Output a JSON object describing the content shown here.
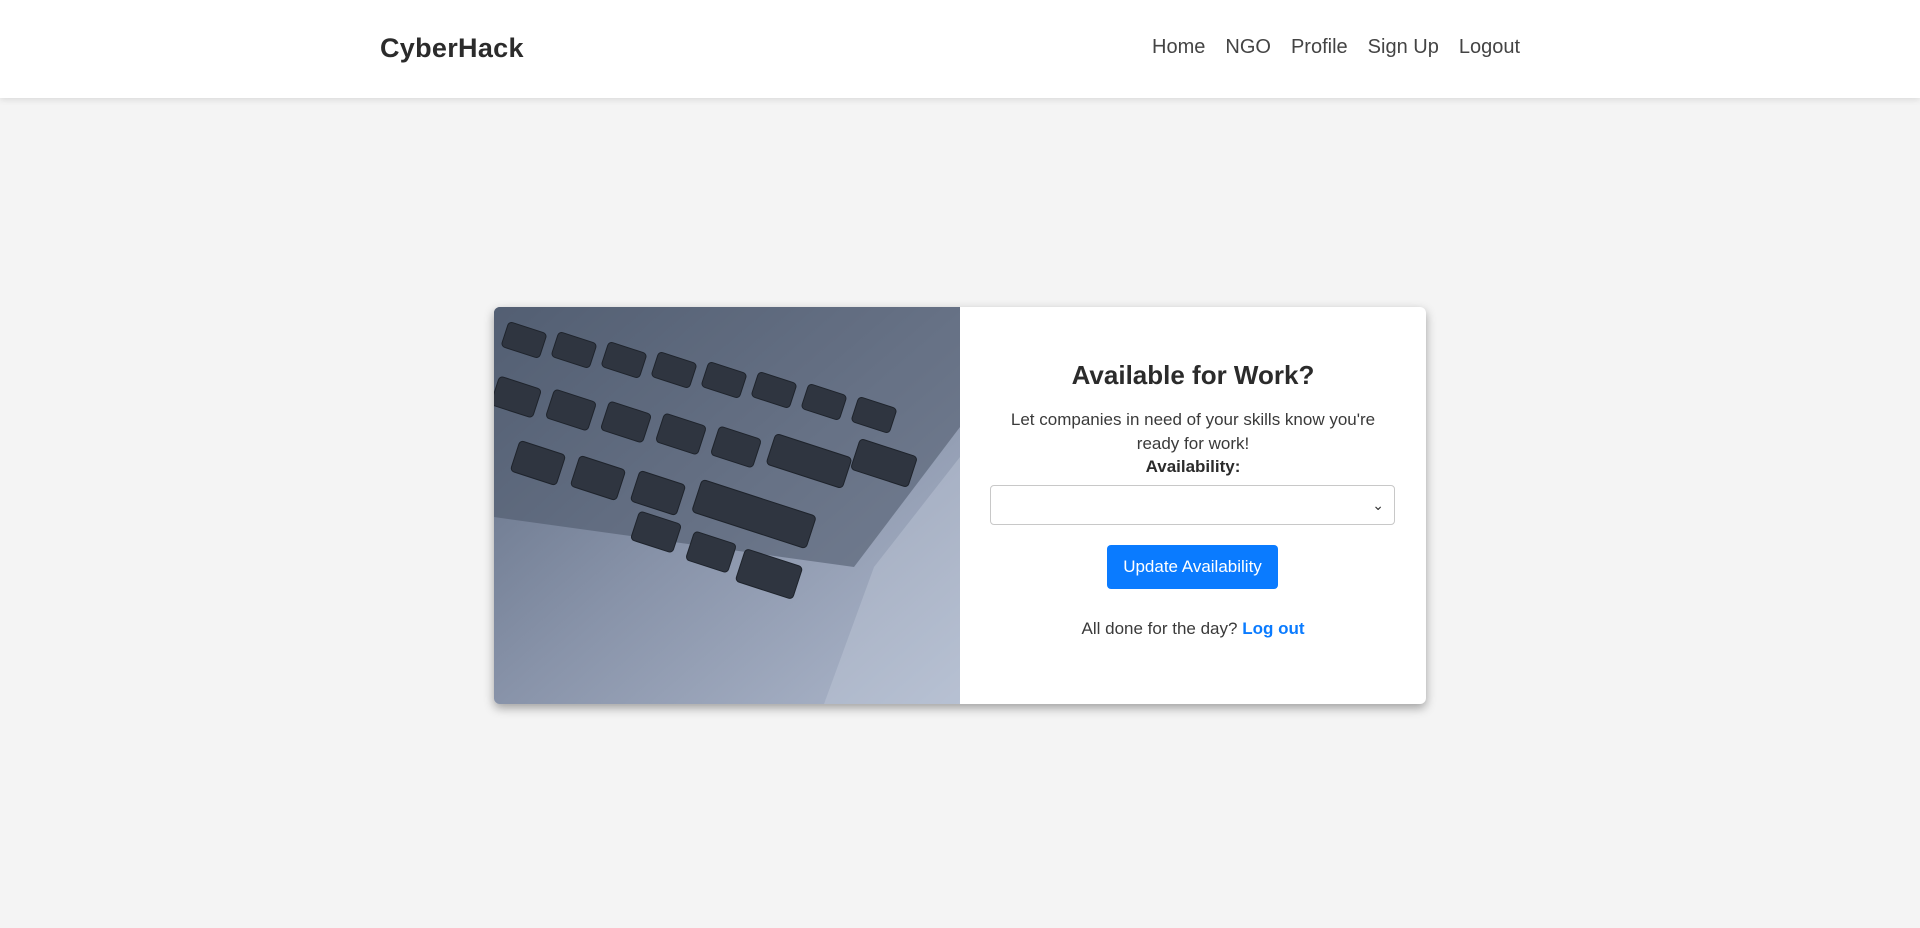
{
  "navbar": {
    "brand": "CyberHack",
    "links": [
      "Home",
      "NGO",
      "Profile",
      "Sign Up",
      "Logout"
    ]
  },
  "card": {
    "title": "Available for Work?",
    "subtitle": "Let companies in need of your skills know you're ready for work!",
    "availability_label": "Availability:",
    "availability_value": "",
    "update_button": "Update Availability",
    "footer_prefix": "All done for the day?",
    "footer_link": "Log out"
  },
  "colors": {
    "accent": "#0a7bff",
    "background": "#f4f4f4"
  },
  "icons": {
    "select_chevron": "chevron-down-icon"
  }
}
